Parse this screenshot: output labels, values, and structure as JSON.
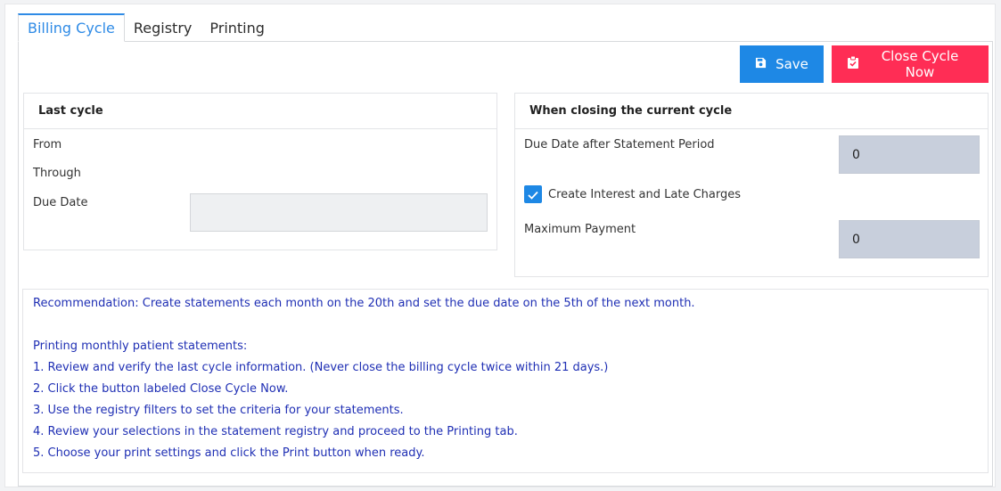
{
  "tabs": [
    {
      "label": "Billing Cycle",
      "active": true
    },
    {
      "label": "Registry",
      "active": false
    },
    {
      "label": "Printing",
      "active": false
    }
  ],
  "toolbar": {
    "save_label": "Save",
    "save_icon": "floppy-disk-icon",
    "close_label": "Close Cycle Now",
    "close_icon": "clipboard-icon"
  },
  "last_cycle": {
    "title": "Last cycle",
    "from_label": "From",
    "through_label": "Through",
    "due_date_label": "Due Date",
    "due_date_value": ""
  },
  "closing": {
    "title": "When closing the current cycle",
    "due_after_label": "Due Date after Statement Period",
    "due_after_value": "0",
    "interest_label": "Create Interest and Late Charges",
    "interest_checked": true,
    "max_payment_label": "Maximum Payment",
    "max_payment_value": "0"
  },
  "notes": {
    "recommendation": "Recommendation: Create statements each month on the 20th and set the due date on the 5th of the next month.",
    "heading": "Printing monthly patient statements:",
    "steps": [
      "1. Review and verify the last cycle information. (Never close the billing cycle twice within 21 days.)",
      "2. Click the button labeled Close Cycle Now.",
      "3. Use the registry filters to set the criteria for your statements.",
      "4. Review your selections in the statement registry and proceed to the Printing tab.",
      "5. Choose your print settings and click the Print button when ready."
    ]
  },
  "colors": {
    "accent": "#1e88e5",
    "danger": "#ff2d55",
    "note_text": "#1f2fb4"
  }
}
